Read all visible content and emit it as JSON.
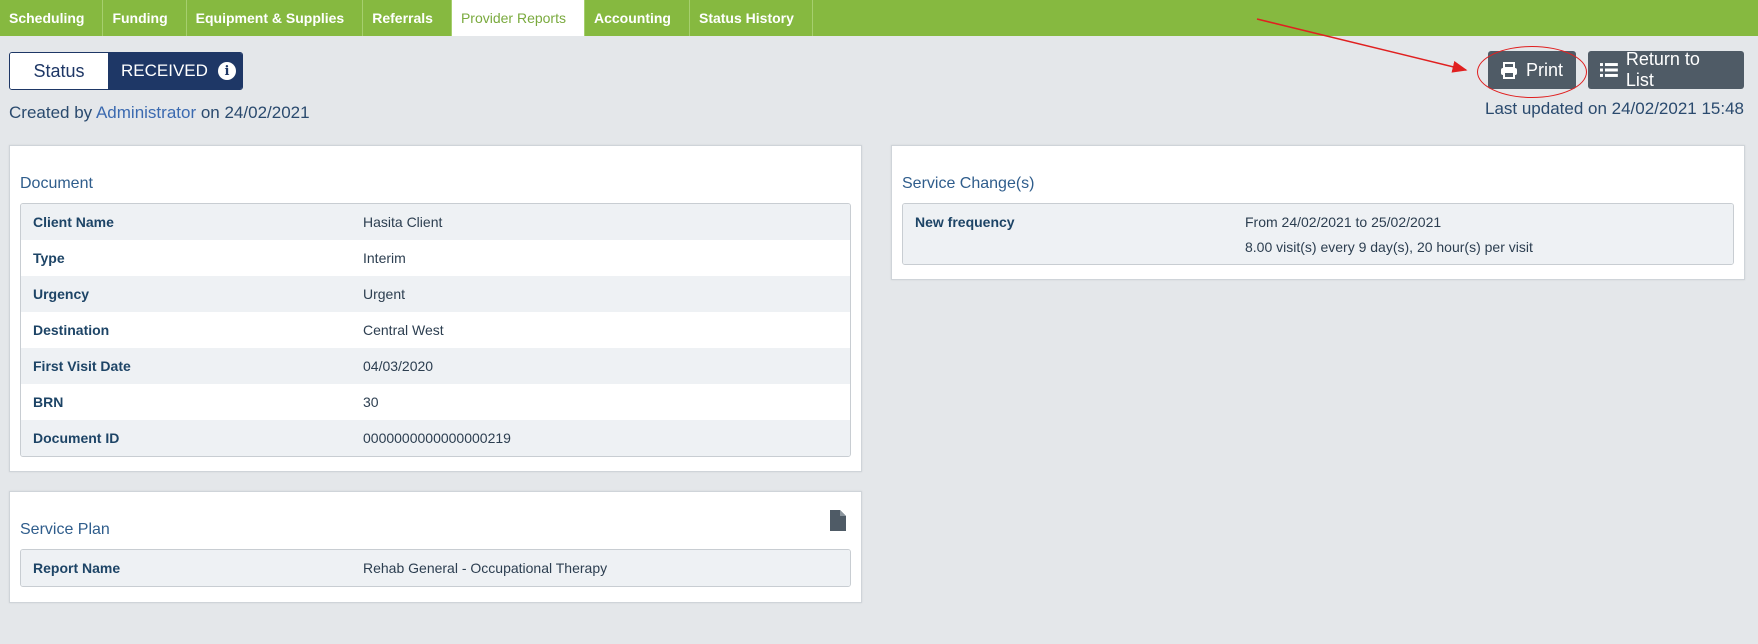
{
  "tabs": [
    {
      "label": "Scheduling"
    },
    {
      "label": "Funding"
    },
    {
      "label": "Equipment & Supplies"
    },
    {
      "label": "Referrals"
    },
    {
      "label": "Provider Reports",
      "active": true
    },
    {
      "label": "Accounting"
    },
    {
      "label": "Status History"
    }
  ],
  "status": {
    "label": "Status",
    "value": "RECEIVED",
    "icon": "info-icon"
  },
  "created": {
    "prefix": "Created by",
    "user": "Administrator",
    "on": "on 24/02/2021"
  },
  "actions": {
    "print_label": "Print",
    "return_label": "Return to List"
  },
  "updated": "Last updated on 24/02/2021 15:48",
  "document": {
    "title": "Document",
    "rows": [
      {
        "key": "Client Name",
        "value": "Hasita Client"
      },
      {
        "key": "Type",
        "value": "Interim"
      },
      {
        "key": "Urgency",
        "value": "Urgent"
      },
      {
        "key": "Destination",
        "value": "Central West"
      },
      {
        "key": "First Visit Date",
        "value": "04/03/2020"
      },
      {
        "key": "BRN",
        "value": "30"
      },
      {
        "key": "Document ID",
        "value": "0000000000000000219"
      }
    ]
  },
  "service_plan": {
    "title": "Service Plan",
    "rows": [
      {
        "key": "Report Name",
        "value": "Rehab General - Occupational Therapy"
      }
    ]
  },
  "service_changes": {
    "title": "Service Change(s)",
    "key": "New frequency",
    "line1": "From 24/02/2021 to 25/02/2021",
    "line2": "8.00 visit(s) every 9 day(s), 20 hour(s) per visit"
  },
  "colors": {
    "tabbar": "#86b940",
    "status_dark": "#1e3766",
    "button": "#4f5b66",
    "annotation": "#e02020"
  }
}
